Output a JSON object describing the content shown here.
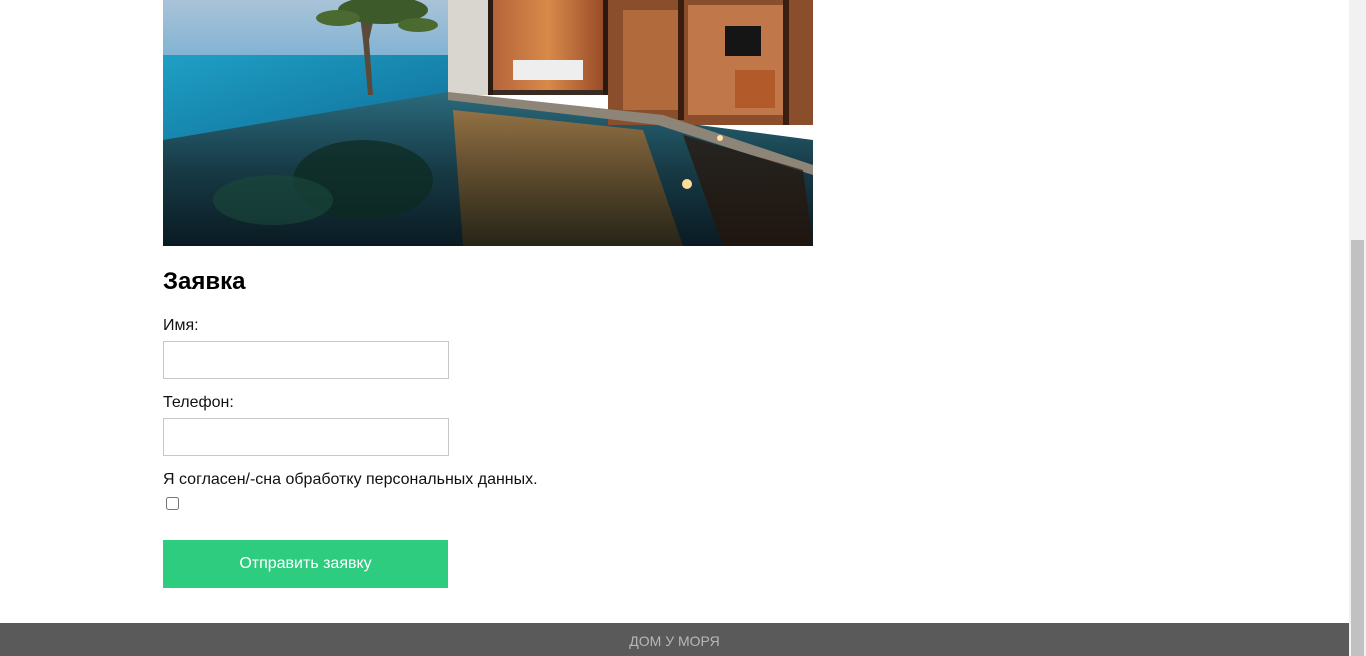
{
  "hero": {
    "image_name": "seaside-villa-pool-photo"
  },
  "form": {
    "title": "Заявка",
    "name_label": "Имя:",
    "name_value": "",
    "phone_label": "Телефон:",
    "phone_value": "",
    "consent_label": "Я согласен/-сна обработку персональных данных.",
    "consent_checked": false,
    "submit_label": "Отправить заявку"
  },
  "footer": {
    "text": "ДОМ У МОРЯ"
  },
  "colors": {
    "submit_bg": "#2ecc7f",
    "footer_bg": "#5a5a5a",
    "footer_text": "#b8b8b8"
  }
}
